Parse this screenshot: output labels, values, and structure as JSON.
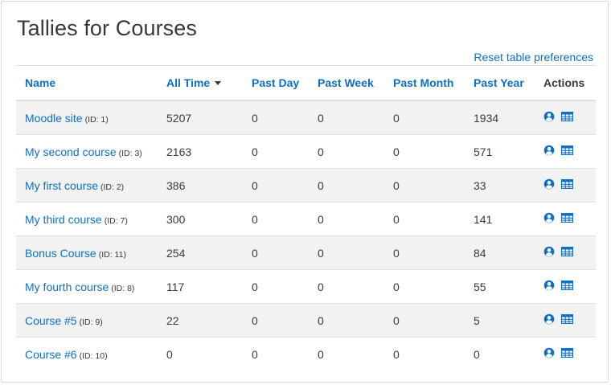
{
  "page": {
    "title": "Tallies for Courses",
    "reset_link": "Reset table preferences"
  },
  "table": {
    "headers": {
      "name": "Name",
      "all_time": "All Time",
      "past_day": "Past Day",
      "past_week": "Past Week",
      "past_month": "Past Month",
      "past_year": "Past Year",
      "actions": "Actions"
    },
    "sort": {
      "column": "all_time",
      "direction": "descending"
    },
    "rows": [
      {
        "name": "Moodle site",
        "id_note": "(ID: 1)",
        "all_time": "5207",
        "past_day": "0",
        "past_week": "0",
        "past_month": "0",
        "past_year": "1934"
      },
      {
        "name": "My second course",
        "id_note": "(ID: 3)",
        "all_time": "2163",
        "past_day": "0",
        "past_week": "0",
        "past_month": "0",
        "past_year": "571"
      },
      {
        "name": "My first course",
        "id_note": "(ID: 2)",
        "all_time": "386",
        "past_day": "0",
        "past_week": "0",
        "past_month": "0",
        "past_year": "33"
      },
      {
        "name": "My third course",
        "id_note": "(ID: 7)",
        "all_time": "300",
        "past_day": "0",
        "past_week": "0",
        "past_month": "0",
        "past_year": "141"
      },
      {
        "name": "Bonus Course",
        "id_note": "(ID: 11)",
        "all_time": "254",
        "past_day": "0",
        "past_week": "0",
        "past_month": "0",
        "past_year": "84"
      },
      {
        "name": "My fourth course",
        "id_note": "(ID: 8)",
        "all_time": "117",
        "past_day": "0",
        "past_week": "0",
        "past_month": "0",
        "past_year": "55"
      },
      {
        "name": "Course #5",
        "id_note": "(ID: 9)",
        "all_time": "22",
        "past_day": "0",
        "past_week": "0",
        "past_month": "0",
        "past_year": "5"
      },
      {
        "name": "Course #6",
        "id_note": "(ID: 10)",
        "all_time": "0",
        "past_day": "0",
        "past_week": "0",
        "past_month": "0",
        "past_year": "0"
      }
    ],
    "row_actions": [
      "user-icon",
      "table-icon"
    ]
  },
  "colors": {
    "link": "#0f6fc5",
    "text": "#373a3c",
    "stripe": "#f2f2f2",
    "border": "#dee2e6"
  }
}
